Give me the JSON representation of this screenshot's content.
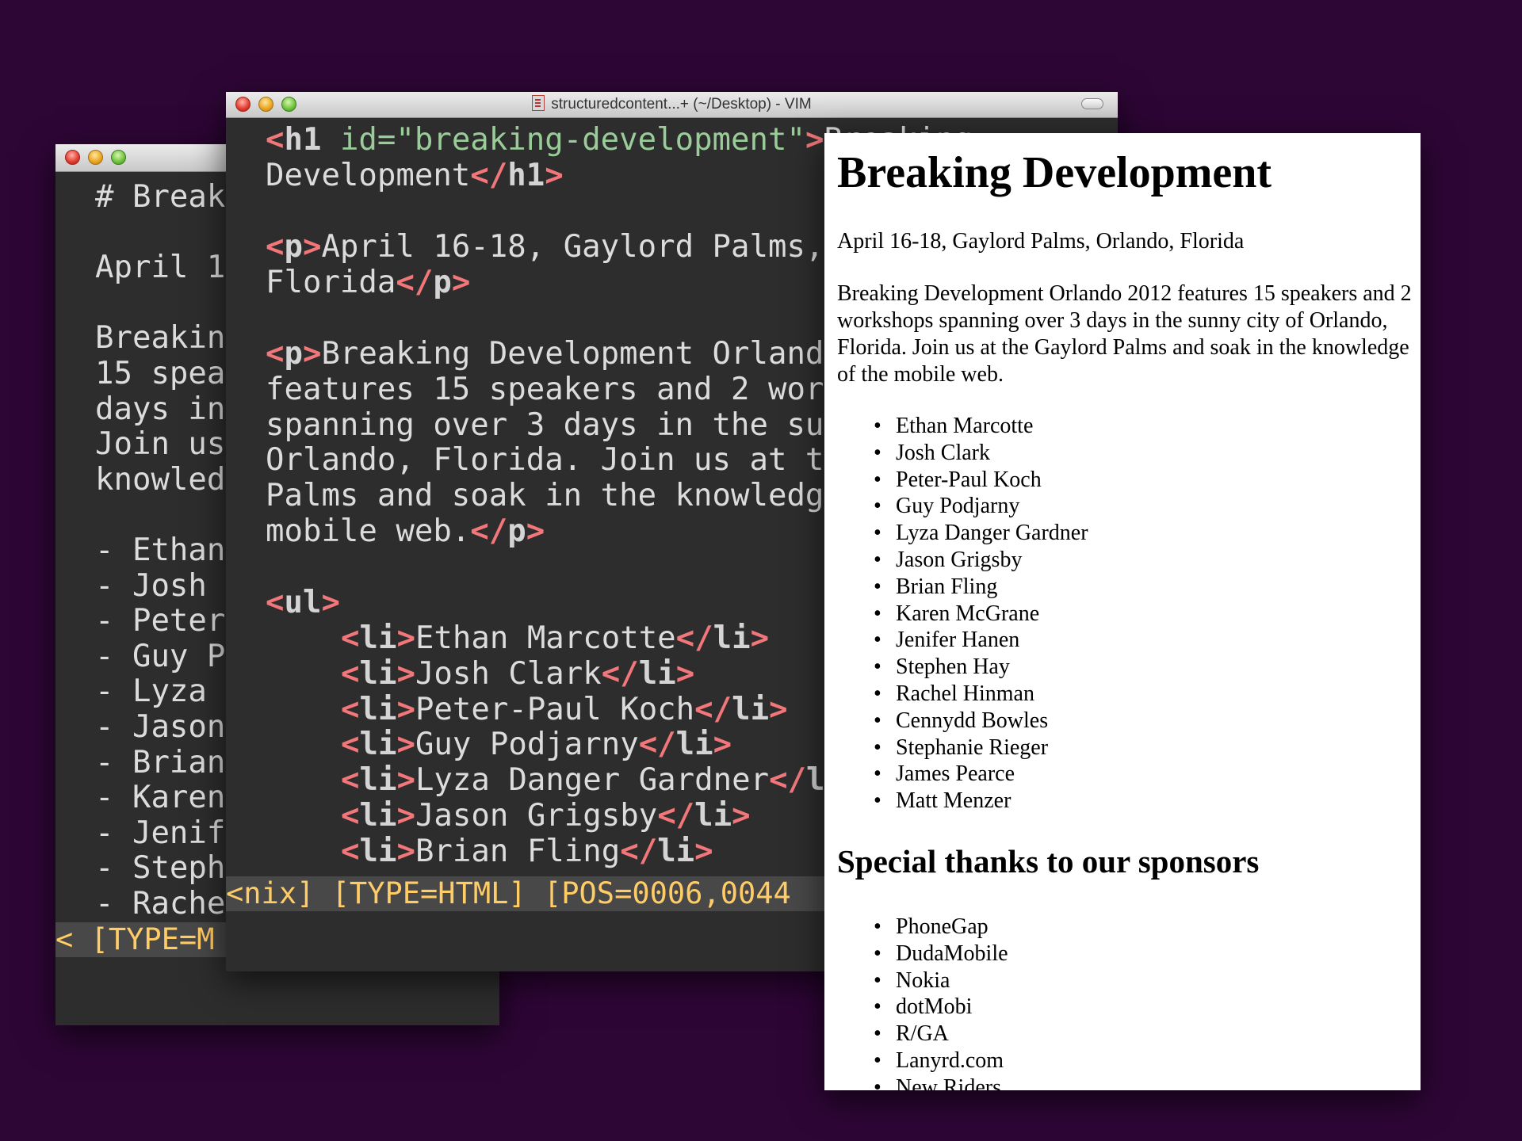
{
  "back_vim": {
    "lines": [
      "# Break",
      "",
      "April 1",
      "",
      "Breakin",
      "15 spea",
      "days in",
      "Join us",
      "knowled",
      "",
      "- Ethan",
      "- Josh ",
      "- Peter",
      "- Guy P",
      "- Lyza ",
      "- Jason",
      "- Brian",
      "- Karen",
      "- Jenif",
      "- Steph",
      "- Rache"
    ],
    "status": "< [TYPE=M"
  },
  "front_vim": {
    "title": "structuredcontent...+ (~/Desktop) - VIM",
    "status": "<nix] [TYPE=HTML] [POS=0006,0044",
    "code": {
      "l1_attr": "id=",
      "l1_str": "\"breaking-development\"",
      "l1_rest": "Breaking",
      "l2_text": "Development",
      "l4_text": "April 16-18, Gaylord Palms,",
      "l5_text": "Florida",
      "l7_text": "Breaking Development Orlando",
      "l8_text": "features 15 speakers and 2 wor",
      "l9_text": "spanning over 3 days in the su",
      "l10_text": "Orlando, Florida. Join us at t",
      "l11_text": "Palms and soak in the knowledg",
      "l12_text": "mobile web.",
      "li_items": [
        "Ethan Marcotte",
        "Josh Clark",
        "Peter-Paul Koch",
        "Guy Podjarny",
        "Lyza Danger Gardner",
        "Jason Grigsby",
        "Brian Fling"
      ]
    }
  },
  "browser": {
    "h1": "Breaking Development",
    "date": "April 16-18, Gaylord Palms, Orlando, Florida",
    "intro": "Breaking Development Orlando 2012 features 15 speakers and 2 workshops spanning over 3 days in the sunny city of Orlando, Florida. Join us at the Gaylord Palms and soak in the knowledge of the mobile web.",
    "speakers": [
      "Ethan Marcotte",
      "Josh Clark",
      "Peter-Paul Koch",
      "Guy Podjarny",
      "Lyza Danger Gardner",
      "Jason Grigsby",
      "Brian Fling",
      "Karen McGrane",
      "Jenifer Hanen",
      "Stephen Hay",
      "Rachel Hinman",
      "Cennydd Bowles",
      "Stephanie Rieger",
      "James Pearce",
      "Matt Menzer"
    ],
    "sponsors_heading": "Special thanks to our sponsors",
    "sponsors": [
      "PhoneGap",
      "DudaMobile",
      "Nokia",
      "dotMobi",
      "R/GA",
      "Lanyrd.com",
      "New Riders"
    ],
    "bullet": "•"
  },
  "colors": {
    "desktop": "#2e0636",
    "editor_bg": "#2d2d2d",
    "tag": "#f2777a",
    "attr": "#99cc99",
    "status_text": "#ffcc66"
  }
}
